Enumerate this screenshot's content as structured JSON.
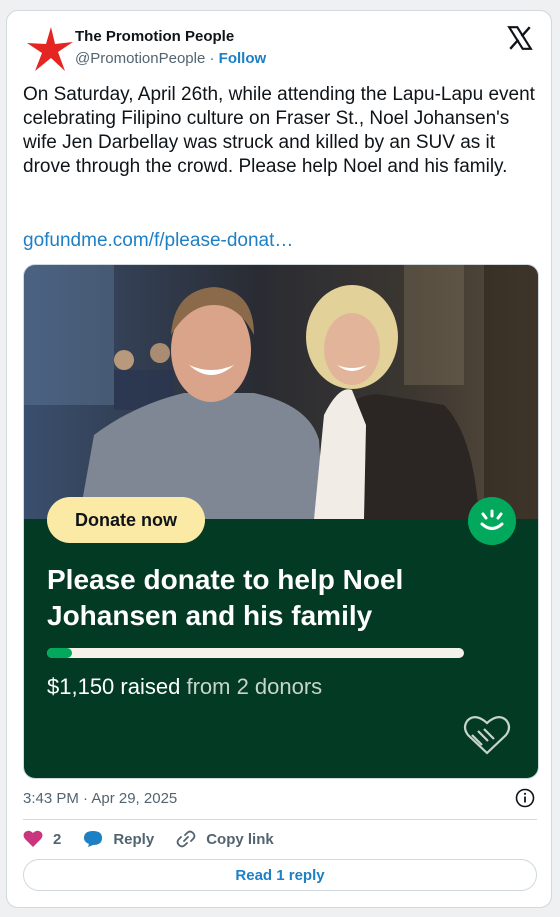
{
  "author": {
    "name": "The Promotion People",
    "handle": "@PromotionPeople",
    "separator": "·",
    "follow_label": "Follow"
  },
  "tweet": {
    "text": "On Saturday, April 26th, while attending the Lapu-Lapu event celebrating  Filipino culture on Fraser St., Noel Johansen's wife Jen Darbellay was struck and killed by an SUV as it drove through the crowd. Please help Noel and his family.",
    "link": "gofundme.com/f/please-donat…"
  },
  "card": {
    "donate_label": "Donate now",
    "title": "Please donate to help Noel Johansen and his family",
    "raised_amount": "$1,150 raised",
    "raised_from": "from 2 donors",
    "progress_fraction": 0.06,
    "accent_color": "#02a95c",
    "background_color": "#023a24"
  },
  "meta": {
    "timestamp": "3:43 PM · Apr 29, 2025"
  },
  "actions": {
    "like_count": "2",
    "reply_label": "Reply",
    "copy_link_label": "Copy link",
    "read_replies_label": "Read 1 reply"
  },
  "icons": [
    "star-avatar-icon",
    "x-logo-icon",
    "gofundme-logo-icon",
    "handshake-heart-icon",
    "info-icon",
    "heart-icon",
    "reply-bubble-icon",
    "link-icon"
  ]
}
